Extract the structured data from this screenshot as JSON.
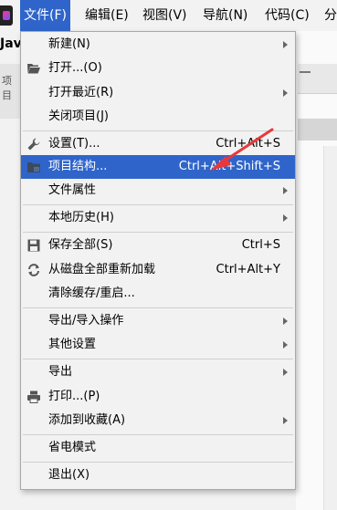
{
  "menubar": {
    "items": [
      {
        "label": "文件(F)",
        "active": true
      },
      {
        "label": "编辑(E)"
      },
      {
        "label": "视图(V)"
      },
      {
        "label": "导航(N)"
      },
      {
        "label": "代码(C)"
      },
      {
        "label": "分"
      }
    ]
  },
  "background": {
    "project_label": "Jav",
    "side_tab_label": "项目"
  },
  "file_menu": {
    "items": [
      {
        "label": "新建(N)",
        "submenu": true
      },
      {
        "label": "打开...(O)",
        "icon": "folder-open-icon"
      },
      {
        "label": "打开最近(R)",
        "submenu": true
      },
      {
        "label": "关闭项目(J)"
      },
      {
        "label": "设置(T)...",
        "shortcut": "Ctrl+Alt+S",
        "icon": "wrench-icon"
      },
      {
        "label": "项目结构...",
        "shortcut": "Ctrl+Alt+Shift+S",
        "icon": "project-structure-icon",
        "highlighted": true
      },
      {
        "label": "文件属性",
        "submenu": true
      },
      {
        "label": "本地历史(H)",
        "submenu": true
      },
      {
        "label": "保存全部(S)",
        "shortcut": "Ctrl+S",
        "icon": "save-icon"
      },
      {
        "label": "从磁盘全部重新加载",
        "shortcut": "Ctrl+Alt+Y",
        "icon": "reload-icon"
      },
      {
        "label": "清除缓存/重启..."
      },
      {
        "label": "导出/导入操作",
        "submenu": true
      },
      {
        "label": "其他设置",
        "submenu": true
      },
      {
        "label": "导出",
        "submenu": true
      },
      {
        "label": "打印...(P)",
        "icon": "printer-icon"
      },
      {
        "label": "添加到收藏(A)",
        "submenu": true
      },
      {
        "label": "省电模式"
      },
      {
        "label": "退出(X)"
      }
    ]
  },
  "colors": {
    "highlight": "#2f65ca",
    "annotation_arrow": "#e8383d"
  }
}
